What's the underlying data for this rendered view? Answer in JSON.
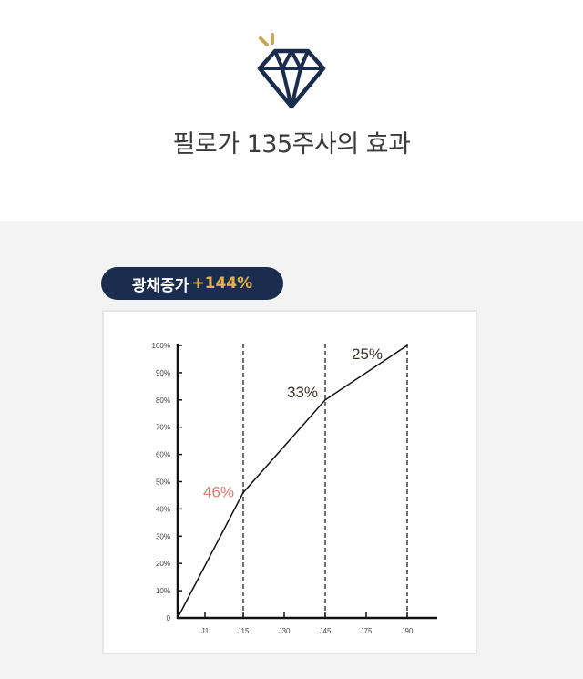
{
  "header": {
    "title": "필로가 135주사의 효과",
    "icon": "diamond-icon",
    "icon_color": "#1b2d4f",
    "sparkle_color": "#c9a55a"
  },
  "badge": {
    "label": "광채증가",
    "highlight": "+144%",
    "bg_color": "#1b2d4f",
    "highlight_color": "#e3b04d"
  },
  "chart_data": {
    "type": "line",
    "categories": [
      "J1",
      "J15",
      "J30",
      "J45",
      "J75",
      "J90"
    ],
    "series": [
      {
        "values": [
          0,
          46,
          null,
          80,
          null,
          100
        ]
      }
    ],
    "yticks": [
      "0",
      "10%",
      "20%",
      "30%",
      "40%",
      "50%",
      "60%",
      "70%",
      "80%",
      "90%",
      "100%"
    ],
    "ylim": [
      0,
      100
    ],
    "vertical_dashed_lines_at": [
      "J15",
      "J45",
      "J90"
    ],
    "annotations": [
      {
        "at": "J15",
        "y": 46,
        "text": "46%",
        "color": "#e07a72"
      },
      {
        "at": "J45",
        "y": 80,
        "text": "33%",
        "color": "#3a302a"
      },
      {
        "at": "J90",
        "y": 100,
        "text": "25%",
        "color": "#3a302a"
      }
    ],
    "grid": false,
    "legend": "none"
  }
}
